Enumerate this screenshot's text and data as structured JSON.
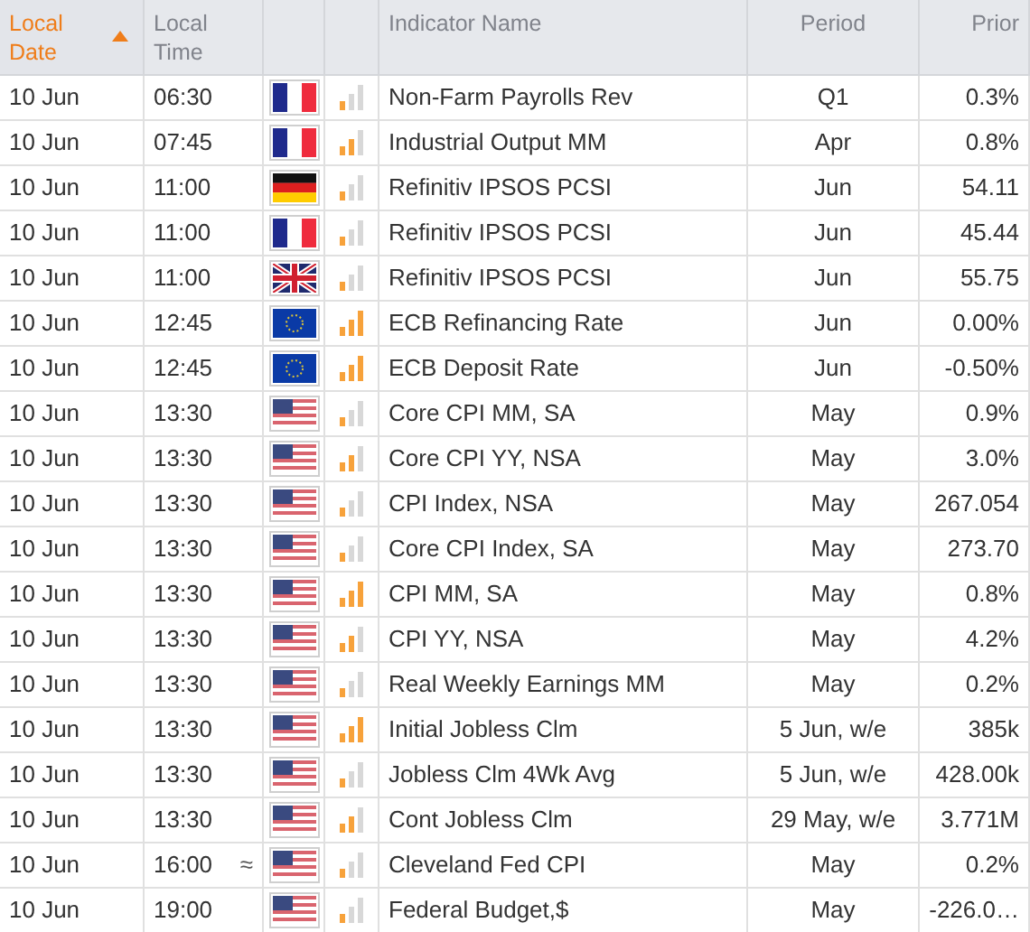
{
  "columns": [
    {
      "label": "Local Date",
      "sorted": true
    },
    {
      "label": "Local Time",
      "sorted": false
    },
    {
      "sorted": false
    },
    {
      "sorted": false
    },
    {
      "label": "Indicator Name",
      "sorted": false
    },
    {
      "label": "Period",
      "sorted": false
    },
    {
      "label": "Prior",
      "sorted": false
    }
  ],
  "rows": [
    {
      "date": "10 Jun",
      "time": "06:30",
      "kind": "fr",
      "bars": [
        {
          "on": true
        },
        {
          "on": false
        },
        {
          "on": false
        }
      ],
      "name": "Non-Farm Payrolls Rev",
      "period": "Q1",
      "prior": "0.3%"
    },
    {
      "date": "10 Jun",
      "time": "07:45",
      "kind": "fr",
      "bars": [
        {
          "on": true
        },
        {
          "on": true
        },
        {
          "on": false
        }
      ],
      "name": "Industrial Output MM",
      "period": "Apr",
      "prior": "0.8%"
    },
    {
      "date": "10 Jun",
      "time": "11:00",
      "kind": "de",
      "bars": [
        {
          "on": true
        },
        {
          "on": false
        },
        {
          "on": false
        }
      ],
      "name": "Refinitiv IPSOS PCSI",
      "period": "Jun",
      "prior": "54.11"
    },
    {
      "date": "10 Jun",
      "time": "11:00",
      "kind": "fr",
      "bars": [
        {
          "on": true
        },
        {
          "on": false
        },
        {
          "on": false
        }
      ],
      "name": "Refinitiv IPSOS PCSI",
      "period": "Jun",
      "prior": "45.44"
    },
    {
      "date": "10 Jun",
      "time": "11:00",
      "kind": "gb",
      "bars": [
        {
          "on": true
        },
        {
          "on": false
        },
        {
          "on": false
        }
      ],
      "name": "Refinitiv IPSOS PCSI",
      "period": "Jun",
      "prior": "55.75"
    },
    {
      "date": "10 Jun",
      "time": "12:45",
      "kind": "eu",
      "bars": [
        {
          "on": true
        },
        {
          "on": true
        },
        {
          "on": true
        }
      ],
      "name": "ECB Refinancing Rate",
      "period": "Jun",
      "prior": "0.00%"
    },
    {
      "date": "10 Jun",
      "time": "12:45",
      "kind": "eu",
      "bars": [
        {
          "on": true
        },
        {
          "on": true
        },
        {
          "on": true
        }
      ],
      "name": "ECB Deposit Rate",
      "period": "Jun",
      "prior": "-0.50%"
    },
    {
      "date": "10 Jun",
      "time": "13:30",
      "kind": "us",
      "bars": [
        {
          "on": true
        },
        {
          "on": false
        },
        {
          "on": false
        }
      ],
      "name": "Core CPI MM, SA",
      "period": "May",
      "prior": "0.9%"
    },
    {
      "date": "10 Jun",
      "time": "13:30",
      "kind": "us",
      "bars": [
        {
          "on": true
        },
        {
          "on": true
        },
        {
          "on": false
        }
      ],
      "name": "Core CPI YY, NSA",
      "period": "May",
      "prior": "3.0%"
    },
    {
      "date": "10 Jun",
      "time": "13:30",
      "kind": "us",
      "bars": [
        {
          "on": true
        },
        {
          "on": false
        },
        {
          "on": false
        }
      ],
      "name": "CPI Index, NSA",
      "period": "May",
      "prior": "267.054"
    },
    {
      "date": "10 Jun",
      "time": "13:30",
      "kind": "us",
      "bars": [
        {
          "on": true
        },
        {
          "on": false
        },
        {
          "on": false
        }
      ],
      "name": "Core CPI Index, SA",
      "period": "May",
      "prior": "273.70"
    },
    {
      "date": "10 Jun",
      "time": "13:30",
      "kind": "us",
      "bars": [
        {
          "on": true
        },
        {
          "on": true
        },
        {
          "on": true
        }
      ],
      "name": "CPI MM, SA",
      "period": "May",
      "prior": "0.8%"
    },
    {
      "date": "10 Jun",
      "time": "13:30",
      "kind": "us",
      "bars": [
        {
          "on": true
        },
        {
          "on": true
        },
        {
          "on": false
        }
      ],
      "name": "CPI YY, NSA",
      "period": "May",
      "prior": "4.2%"
    },
    {
      "date": "10 Jun",
      "time": "13:30",
      "kind": "us",
      "bars": [
        {
          "on": true
        },
        {
          "on": false
        },
        {
          "on": false
        }
      ],
      "name": "Real Weekly Earnings MM",
      "period": "May",
      "prior": "0.2%"
    },
    {
      "date": "10 Jun",
      "time": "13:30",
      "kind": "us",
      "bars": [
        {
          "on": true
        },
        {
          "on": true
        },
        {
          "on": true
        }
      ],
      "name": "Initial Jobless Clm",
      "period": "5 Jun, w/e",
      "prior": "385k"
    },
    {
      "date": "10 Jun",
      "time": "13:30",
      "kind": "us",
      "bars": [
        {
          "on": true
        },
        {
          "on": false
        },
        {
          "on": false
        }
      ],
      "name": "Jobless Clm 4Wk Avg",
      "period": "5 Jun, w/e",
      "prior": "428.00k"
    },
    {
      "date": "10 Jun",
      "time": "13:30",
      "kind": "us",
      "bars": [
        {
          "on": true
        },
        {
          "on": true
        },
        {
          "on": false
        }
      ],
      "name": "Cont Jobless Clm",
      "period": "29 May, w/e",
      "prior": "3.771M"
    },
    {
      "date": "10 Jun",
      "time": "16:00",
      "mark": "≈",
      "kind": "us",
      "bars": [
        {
          "on": true
        },
        {
          "on": false
        },
        {
          "on": false
        }
      ],
      "name": "Cleveland Fed CPI",
      "period": "May",
      "prior": "0.2%"
    },
    {
      "date": "10 Jun",
      "time": "19:00",
      "kind": "us",
      "bars": [
        {
          "on": true
        },
        {
          "on": false
        },
        {
          "on": false
        }
      ],
      "name": "Federal Budget,$",
      "period": "May",
      "prior": "-226.0…"
    }
  ]
}
